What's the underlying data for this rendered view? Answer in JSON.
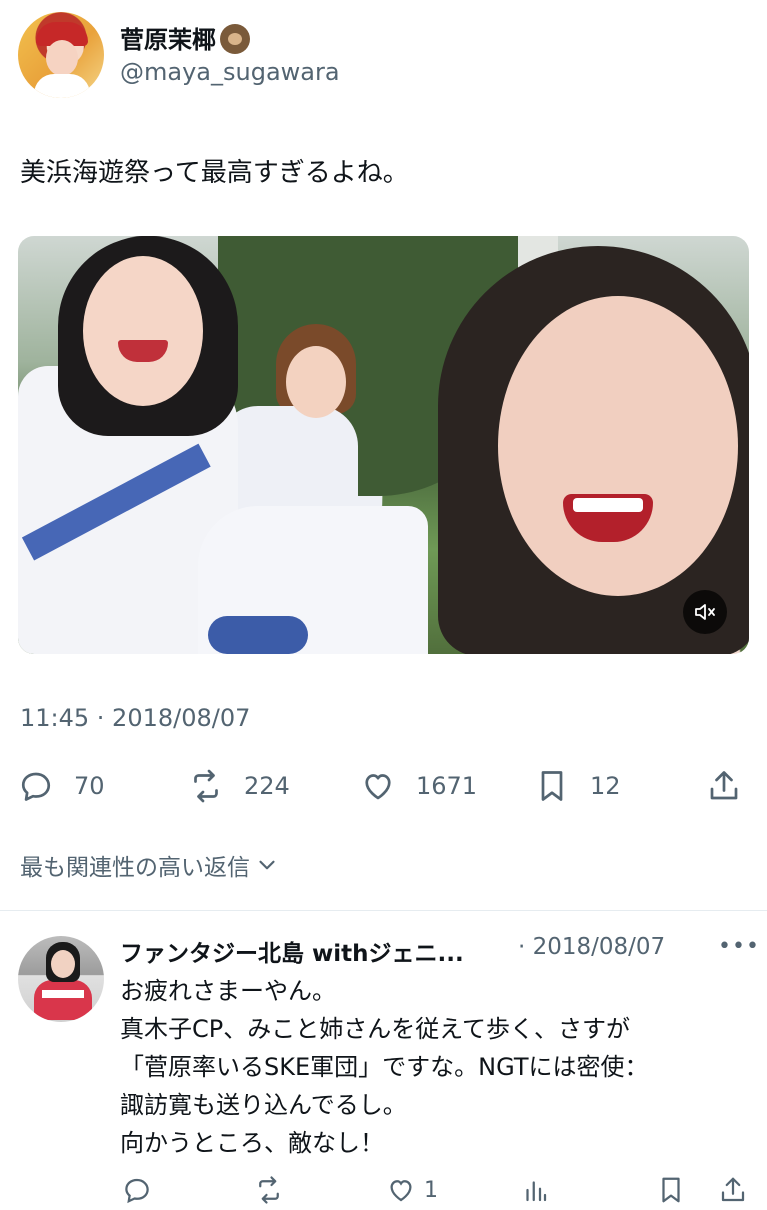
{
  "author": {
    "display_name": "菅原茉椰",
    "emoji": "sloth-emoji",
    "handle": "@maya_sugawara"
  },
  "tweet": {
    "text": "美浜海遊祭って最高すぎるよね。",
    "timestamp": "11:45 · 2018/08/07",
    "media": {
      "type": "video",
      "muted": true
    }
  },
  "actions": {
    "replies": "70",
    "retweets": "224",
    "likes": "1671",
    "bookmarks": "12"
  },
  "replies_filter": {
    "label": "最も関連性の高い返信"
  },
  "reply": {
    "display_name": "ファンタジー北島 withジェニ...",
    "date": "· 2018/08/07",
    "lines": [
      "お疲れさまーやん。",
      "真木子CP、みこと姉さんを従えて歩く、さすが",
      "「菅原率いるSKE軍団」ですな。NGTには密使：",
      "諏訪寛も送り込んでるし。",
      "向かうところ、敵なし！"
    ],
    "likes": "1"
  }
}
